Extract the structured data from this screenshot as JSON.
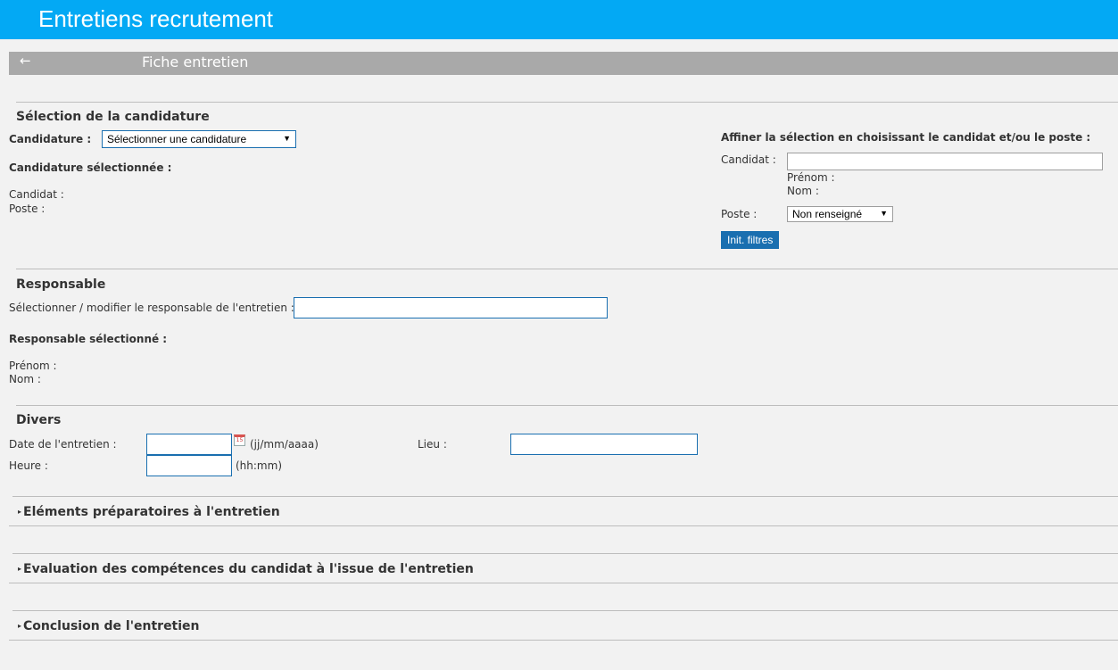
{
  "app": {
    "title": "Entretiens recrutement"
  },
  "subbar": {
    "back_icon": "arrow-left-icon",
    "back_glyph": "←",
    "title": "Fiche entretien"
  },
  "candidature": {
    "section_title": "Sélection de la candidature",
    "label": "Candidature :",
    "select_value": "Sélectionner une candidature",
    "selected_title": "Candidature sélectionnée :",
    "candidat_label": "Candidat :",
    "poste_label": "Poste :",
    "filter": {
      "title": "Affiner la sélection en choisissant le candidat et/ou le poste :",
      "candidat_label": "Candidat :",
      "candidat_value": "",
      "prenom_label": "Prénom :",
      "nom_label": "Nom :",
      "poste_label": "Poste :",
      "poste_value": "Non renseigné",
      "reset_button": "Init. filtres"
    }
  },
  "responsable": {
    "section_title": "Responsable",
    "select_label": "Sélectionner / modifier le responsable de l'entretien :",
    "input_value": "",
    "selected_title": "Responsable sélectionné :",
    "prenom_label": "Prénom :",
    "nom_label": "Nom :"
  },
  "divers": {
    "section_title": "Divers",
    "date_label": "Date de l'entretien :",
    "date_value": "",
    "date_hint": "(jj/mm/aaaa)",
    "calendar_icon_text": "15",
    "heure_label": "Heure :",
    "heure_value": "",
    "heure_hint": "(hh:mm)",
    "lieu_label": "Lieu :",
    "lieu_value": ""
  },
  "collapsibles": {
    "elements": "Eléments préparatoires à l'entretien",
    "evaluation": "Evaluation des compétences du candidat à l'issue de l'entretien",
    "conclusion": "Conclusion de l'entretien",
    "arrow_glyph": "▸"
  },
  "colors": {
    "header": "#03a9f4",
    "subbar": "#a9a9a9",
    "accent": "#1a6fb0",
    "background": "#f2f2f2"
  }
}
